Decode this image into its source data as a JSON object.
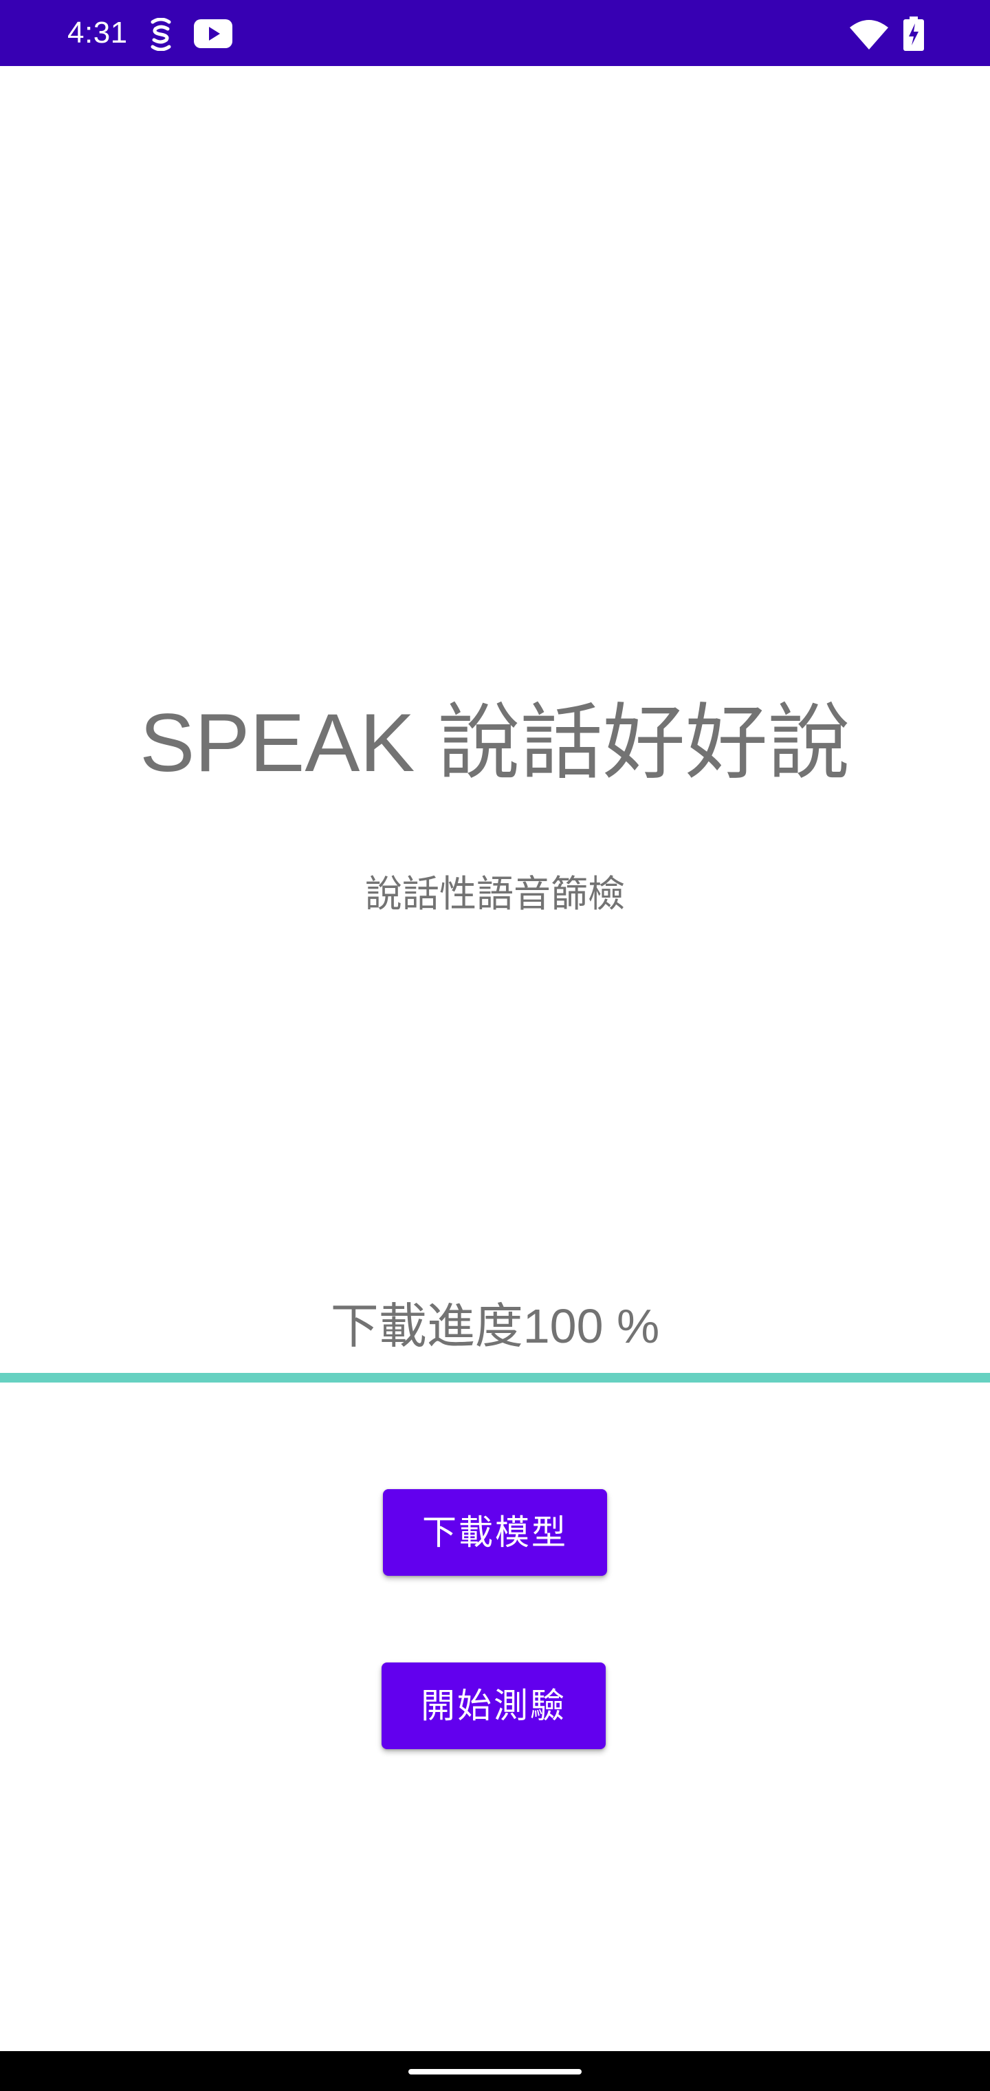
{
  "status_bar": {
    "time": "4:31",
    "background_color": "#3700b3",
    "icons": [
      "accessibility-icon",
      "youtube-icon",
      "wifi-icon",
      "battery-charging-icon"
    ]
  },
  "main": {
    "title": "SPEAK 說話好好說",
    "subtitle": "說話性語音篩檢",
    "progress_label": "下載進度100 %",
    "progress_fraction": 1.0,
    "progress_color": "#66d1c1"
  },
  "buttons": {
    "download_model_label": "下載模型",
    "start_test_label": "開始測驗",
    "color": "#6200ee"
  },
  "nav_bar": {
    "icons": [
      "home-handle-icon"
    ]
  }
}
